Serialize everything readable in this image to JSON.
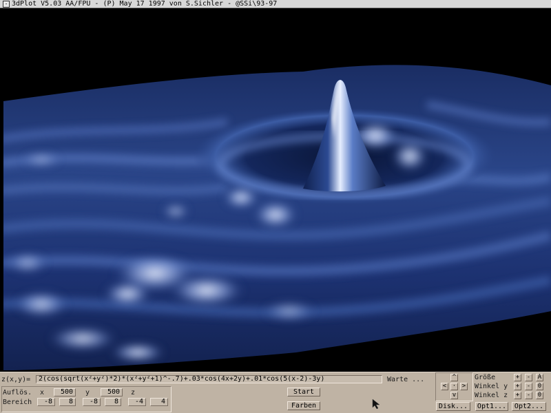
{
  "window": {
    "title": "3dPlot V5.03 AA/FPU - (P) May 17 1997 von S.Sichler - @SSi\\93-97",
    "system_menu_glyph": "-"
  },
  "formula": {
    "label": "z(x,y)=",
    "value": "2(cos(sqrt(x²+y²)*2)*(x²+y²+1)^-.7)+.03*cos(4x+2y)+.01*cos(5(x-2)-3y)",
    "status": "Warte ..."
  },
  "resolution": {
    "label": "Auflös.",
    "x_label": "x",
    "x_value": "500",
    "y_label": "y",
    "y_value": "500",
    "z_label": "z"
  },
  "range": {
    "label": "Bereich",
    "x_min": "-8",
    "x_max": "8",
    "y_min": "-8",
    "y_max": "8",
    "z_min": "-4",
    "z_max": "4"
  },
  "buttons": {
    "start": "Start",
    "colors": "Farben",
    "disk": "Disk...",
    "opt1": "Opt1...",
    "opt2": "Opt2..."
  },
  "navigation": {
    "up": "^",
    "down": "v",
    "left": "<",
    "right": ">",
    "center": "·"
  },
  "adjust": {
    "size_label": "Größe",
    "angle_y_label": "Winkel y",
    "angle_z_label": "Winkel z",
    "plus": "+",
    "minus": "-",
    "toggle": "A",
    "reset": "0"
  },
  "colors": {
    "panel": "#bfb3a4",
    "plot_background": "#000000",
    "surface_dark": "#0c1f4a",
    "surface_mid": "#3a5aa0",
    "surface_light": "#dfe8ff"
  }
}
